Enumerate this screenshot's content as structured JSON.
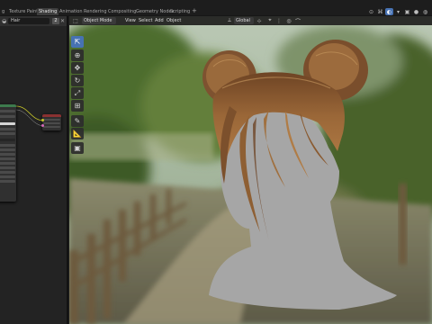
{
  "workspace_tabs": [
    "g",
    "Texture Paint",
    "Shading",
    "Animation",
    "Rendering",
    "Compositing",
    "Geometry Nodes",
    "Scripting",
    "+"
  ],
  "active_tab": "Shading",
  "node_editor": {
    "material_name": "Hair",
    "user_count": "2"
  },
  "viewport_header": {
    "mode": "Object Mode",
    "menus": [
      "View",
      "Select",
      "Add",
      "Object"
    ],
    "transform_orientation": "Global"
  },
  "toolbar": {
    "tools": [
      "select-box-icon",
      "cursor-icon",
      "move-icon",
      "rotate-icon",
      "scale-icon",
      "transform-icon",
      "annotate-icon",
      "measure-icon",
      "add-cube-icon"
    ],
    "active_tool": "select-box-icon"
  },
  "colors": {
    "accent": "#4772b3",
    "header_bg": "#303030",
    "panel_bg": "#1d1d1d",
    "mannequin": "#a6a6a6",
    "hair": "#8a5a2e"
  }
}
